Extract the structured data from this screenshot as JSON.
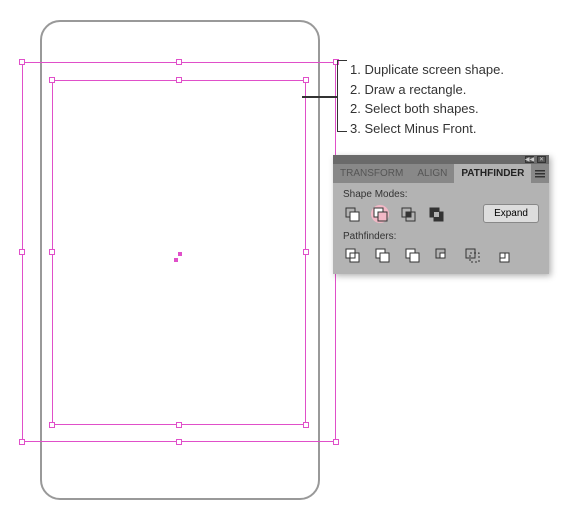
{
  "instructions": {
    "step1": "1. Duplicate screen shape.",
    "step2": "2. Draw a rectangle.",
    "step3": "2. Select both shapes.",
    "step4": "3. Select Minus Front."
  },
  "panel": {
    "tabs": {
      "transform": "TRANSFORM",
      "align": "ALIGN",
      "pathfinder": "PATHFINDER"
    },
    "shape_modes_label": "Shape Modes:",
    "pathfinders_label": "Pathfinders:",
    "expand_label": "Expand"
  }
}
